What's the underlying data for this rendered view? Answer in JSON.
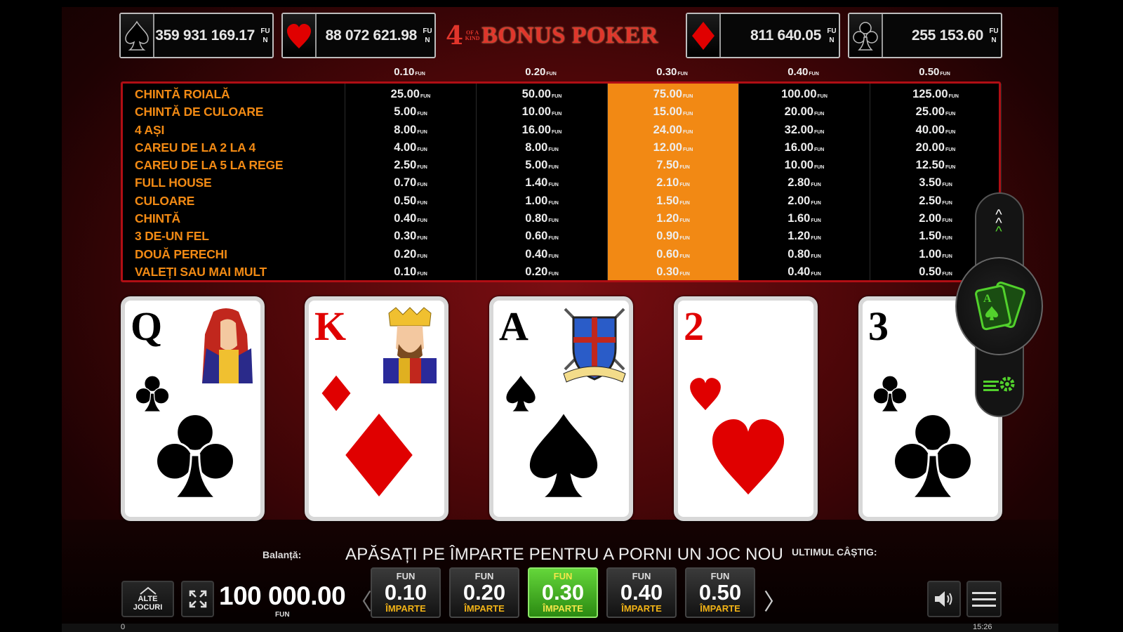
{
  "jackpots": [
    {
      "suit": "spade-icon",
      "amount": "359 931 169.17",
      "currency": "FUN"
    },
    {
      "suit": "heart-icon",
      "amount": "88 072 621.98",
      "currency": "FUN"
    },
    {
      "suit": "diamond-icon",
      "amount": "811 640.05",
      "currency": "FUN"
    },
    {
      "suit": "club-icon",
      "amount": "255 153.60",
      "currency": "FUN"
    }
  ],
  "logo": {
    "four": "4",
    "ofa": "OF A KIND",
    "title": "BONUS POKER"
  },
  "coin_values": [
    "0.10",
    "0.20",
    "0.30",
    "0.40",
    "0.50"
  ],
  "currency": "FUN",
  "hands": [
    "CHINTĂ ROIALĂ",
    "CHINTĂ DE CULOARE",
    "4 AȘI",
    "CAREU DE LA 2 LA 4",
    "CAREU DE LA 5 LA REGE",
    "FULL HOUSE",
    "CULOARE",
    "CHINTĂ",
    "3 DE-UN FEL",
    "DOUĂ PERECHI",
    "VALEȚI SAU MAI MULT"
  ],
  "paytable": [
    [
      "25.00",
      "5.00",
      "8.00",
      "4.00",
      "2.50",
      "0.70",
      "0.50",
      "0.40",
      "0.30",
      "0.20",
      "0.10"
    ],
    [
      "50.00",
      "10.00",
      "16.00",
      "8.00",
      "5.00",
      "1.40",
      "1.00",
      "0.80",
      "0.60",
      "0.40",
      "0.20"
    ],
    [
      "75.00",
      "15.00",
      "24.00",
      "12.00",
      "7.50",
      "2.10",
      "1.50",
      "1.20",
      "0.90",
      "0.60",
      "0.30"
    ],
    [
      "100.00",
      "20.00",
      "32.00",
      "16.00",
      "10.00",
      "2.80",
      "2.00",
      "1.60",
      "1.20",
      "0.80",
      "0.40"
    ],
    [
      "125.00",
      "25.00",
      "40.00",
      "20.00",
      "12.50",
      "3.50",
      "2.50",
      "2.00",
      "1.50",
      "1.00",
      "0.50"
    ]
  ],
  "active_column": 2,
  "cards": [
    {
      "rank": "Q",
      "suit": "club-icon",
      "color": "black"
    },
    {
      "rank": "K",
      "suit": "diamond-icon",
      "color": "red"
    },
    {
      "rank": "A",
      "suit": "spade-icon",
      "color": "black"
    },
    {
      "rank": "2",
      "suit": "heart-icon",
      "color": "red"
    },
    {
      "rank": "3",
      "suit": "club-icon",
      "color": "black"
    }
  ],
  "bottom": {
    "balance_label": "Balanță:",
    "message": "APĂSAȚI PE ÎMPARTE PENTRU A PORNI UN JOC NOU",
    "last_win_label": "ULTIMUL CÂȘTIG:",
    "home_label_1": "ALTE",
    "home_label_2": "JOCURI",
    "balance": "100 000.00",
    "balance_currency": "FUN",
    "prev_arrow": "〈",
    "next_arrow": "〉",
    "status_left": "0",
    "status_time": "15:26"
  },
  "bets": [
    {
      "currency": "FUN",
      "value": "0.10",
      "action": "ÎMPARTE"
    },
    {
      "currency": "FUN",
      "value": "0.20",
      "action": "ÎMPARTE"
    },
    {
      "currency": "FUN",
      "value": "0.30",
      "action": "ÎMPARTE"
    },
    {
      "currency": "FUN",
      "value": "0.40",
      "action": "ÎMPARTE"
    },
    {
      "currency": "FUN",
      "value": "0.50",
      "action": "ÎMPARTE"
    }
  ],
  "active_bet": 2,
  "colors": {
    "accent_orange": "#f28914",
    "table_border": "#b00e14",
    "active_green": "#52d12c",
    "red_suit": "#e00000"
  }
}
